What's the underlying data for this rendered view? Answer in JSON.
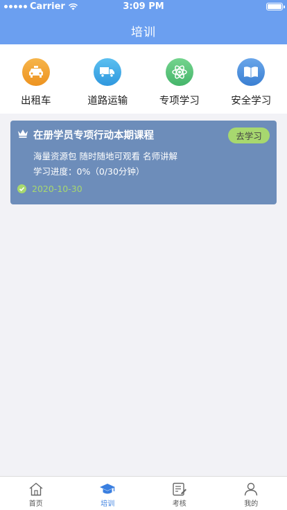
{
  "status_bar": {
    "carrier": "Carrier",
    "time": "3:09 PM"
  },
  "header": {
    "title": "培训"
  },
  "categories": [
    {
      "label": "出租车",
      "icon": "taxi-icon",
      "color": "#f0a12f"
    },
    {
      "label": "道路运输",
      "icon": "truck-icon",
      "color": "#3ea9e6"
    },
    {
      "label": "专项学习",
      "icon": "atom-icon",
      "color": "#58c27a"
    },
    {
      "label": "安全学习",
      "icon": "book-icon",
      "color": "#4a8fdc"
    }
  ],
  "course": {
    "title": "在册学员专项行动本期课程",
    "action_label": "去学习",
    "description": "海量资源包 随时随地可观看 名师讲解",
    "progress": "学习进度：0%（0/30分钟）",
    "date": "2020-10-30"
  },
  "tabs": [
    {
      "label": "首页",
      "icon": "home-icon"
    },
    {
      "label": "培训",
      "icon": "graduation-cap-icon",
      "active": true
    },
    {
      "label": "考核",
      "icon": "exam-icon"
    },
    {
      "label": "我的",
      "icon": "user-icon"
    }
  ],
  "colors": {
    "header": "#6b9ff0",
    "card": "#6d8dba",
    "accent_green": "#a7d86f",
    "tab_active": "#3a7fe0"
  }
}
